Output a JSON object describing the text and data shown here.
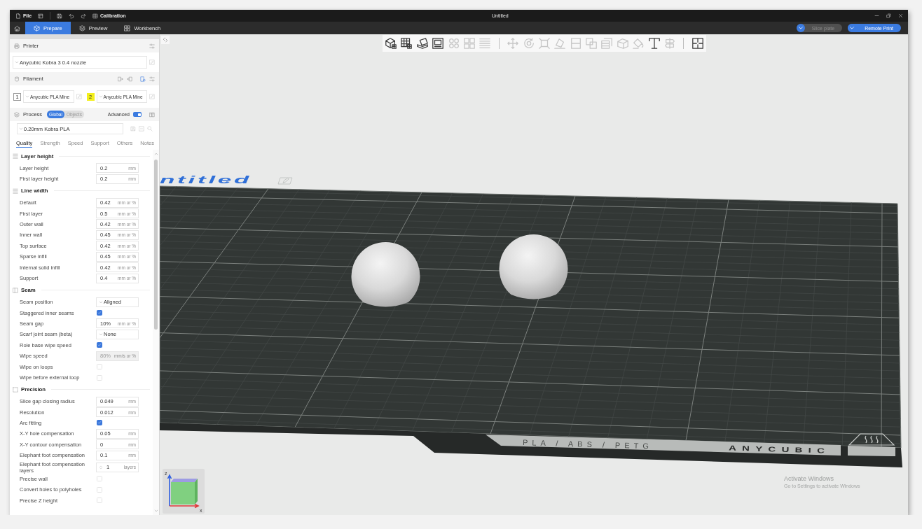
{
  "title_bar": {
    "menu_label": "File",
    "calibration_label": "Calibration",
    "title": "Untitled"
  },
  "tabs": [
    {
      "label": "Prepare",
      "selected": true
    },
    {
      "label": "Preview",
      "selected": false
    },
    {
      "label": "Workbench",
      "selected": false
    }
  ],
  "actions": [
    {
      "label": "Slice plate",
      "disabled": true
    },
    {
      "label": "Remote Print",
      "disabled": false
    }
  ],
  "sidebar": {
    "printer": {
      "title": "Printer",
      "preset": "Anycubic Kobra 3 0.4 nozzle"
    },
    "filament": {
      "title": "Filament",
      "slots": [
        {
          "number": "1",
          "name": "Anycubic PLA Mine",
          "color": "#ffffff"
        },
        {
          "number": "2",
          "name": "Anycubic PLA Mine",
          "color": "#f3ef1c"
        }
      ]
    },
    "process": {
      "title": "Process",
      "scopes": [
        {
          "label": "Global",
          "selected": true
        },
        {
          "label": "Objects",
          "selected": false
        }
      ],
      "advanced": {
        "label": "Advanced",
        "on": true
      },
      "preset": "0.20mm Kobra PLA"
    },
    "setting_tabs": [
      {
        "label": "Quality",
        "selected": true
      },
      {
        "label": "Strength",
        "selected": false
      },
      {
        "label": "Speed",
        "selected": false
      },
      {
        "label": "Support",
        "selected": false
      },
      {
        "label": "Others",
        "selected": false
      },
      {
        "label": "Notes",
        "selected": false
      }
    ],
    "groups": [
      {
        "title": "Layer height",
        "settings": [
          {
            "kind": "number",
            "label": "Layer height",
            "value": "0.2",
            "unit": "mm",
            "disabled": false
          },
          {
            "kind": "number",
            "label": "First layer height",
            "value": "0.2",
            "unit": "mm",
            "disabled": false
          }
        ]
      },
      {
        "title": "Line width",
        "settings": [
          {
            "kind": "number",
            "label": "Default",
            "value": "0.42",
            "unit": "mm or %",
            "disabled": false
          },
          {
            "kind": "number",
            "label": "First layer",
            "value": "0.5",
            "unit": "mm or %",
            "disabled": false
          },
          {
            "kind": "number",
            "label": "Outer wall",
            "value": "0.42",
            "unit": "mm or %",
            "disabled": false
          },
          {
            "kind": "number",
            "label": "Inner wall",
            "value": "0.45",
            "unit": "mm or %",
            "disabled": false
          },
          {
            "kind": "number",
            "label": "Top surface",
            "value": "0.42",
            "unit": "mm or %",
            "disabled": false
          },
          {
            "kind": "number",
            "label": "Sparse infill",
            "value": "0.45",
            "unit": "mm or %",
            "disabled": false
          },
          {
            "kind": "number",
            "label": "Internal solid infill",
            "value": "0.42",
            "unit": "mm or %",
            "disabled": false
          },
          {
            "kind": "number",
            "label": "Support",
            "value": "0.4",
            "unit": "mm or %",
            "disabled": false
          }
        ]
      },
      {
        "title": "Seam",
        "settings": [
          {
            "kind": "select",
            "label": "Seam position",
            "value": "Aligned",
            "disabled": false
          },
          {
            "kind": "checkbox",
            "label": "Staggered inner seams",
            "checked": true,
            "disabled": false
          },
          {
            "kind": "number",
            "label": "Seam gap",
            "value": "10%",
            "unit": "mm or %",
            "disabled": false
          },
          {
            "kind": "select",
            "label": "Scarf joint seam (beta)",
            "value": "None",
            "disabled": false
          },
          {
            "kind": "checkbox",
            "label": "Role base wipe speed",
            "checked": true,
            "disabled": false
          },
          {
            "kind": "number",
            "label": "Wipe speed",
            "value": "80%",
            "unit": "mm/s or %",
            "disabled": true
          },
          {
            "kind": "checkbox",
            "label": "Wipe on loops",
            "checked": false,
            "disabled": false
          },
          {
            "kind": "checkbox",
            "label": "Wipe before external loop",
            "checked": false,
            "disabled": false
          }
        ]
      },
      {
        "title": "Precision",
        "settings": [
          {
            "kind": "number",
            "label": "Slice gap closing radius",
            "value": "0.049",
            "unit": "mm",
            "disabled": false
          },
          {
            "kind": "number",
            "label": "Resolution",
            "value": "0.012",
            "unit": "mm",
            "disabled": false
          },
          {
            "kind": "checkbox",
            "label": "Arc fitting",
            "checked": true,
            "disabled": false
          },
          {
            "kind": "number",
            "label": "X-Y hole compensation",
            "value": "0.05",
            "unit": "mm",
            "disabled": false
          },
          {
            "kind": "number",
            "label": "X-Y contour compensation",
            "value": "0",
            "unit": "mm",
            "disabled": false
          },
          {
            "kind": "number",
            "label": "Elephant foot compensation",
            "value": "0.1",
            "unit": "mm",
            "disabled": false
          },
          {
            "kind": "spin",
            "label": "Elephant foot compensation layers",
            "value": "1",
            "unit": "layers",
            "disabled": false
          },
          {
            "kind": "checkbox",
            "label": "Precise wall",
            "checked": false,
            "disabled": false
          },
          {
            "kind": "checkbox",
            "label": "Convert holes to polyholes",
            "checked": false,
            "disabled": false
          },
          {
            "kind": "checkbox",
            "label": "Precise Z height",
            "checked": false,
            "disabled": false
          }
        ]
      }
    ]
  },
  "toolbar_groups": [
    [
      {
        "disabled": false
      },
      {
        "disabled": false
      },
      {
        "disabled": false
      },
      {
        "disabled": false
      },
      {
        "disabled": true
      },
      {
        "disabled": true
      },
      {
        "disabled": true
      }
    ],
    [
      {
        "disabled": true
      },
      {
        "disabled": true
      },
      {
        "disabled": true
      },
      {
        "disabled": true
      },
      {
        "disabled": true
      },
      {
        "disabled": true
      },
      {
        "disabled": true
      },
      {
        "disabled": true
      },
      {
        "disabled": true
      },
      {
        "disabled": false
      },
      {
        "disabled": true
      }
    ],
    [
      {
        "disabled": false
      }
    ]
  ],
  "viewport": {
    "plate_name": "ntitled",
    "bed_labels": {
      "material": "PLA / ABS / PETG",
      "brand": "ANYCUBIC"
    },
    "axis_labels": [
      "z",
      "x"
    ]
  },
  "os_notice": {
    "title": "Activate Windows",
    "text": "Go to Settings to activate Windows"
  }
}
